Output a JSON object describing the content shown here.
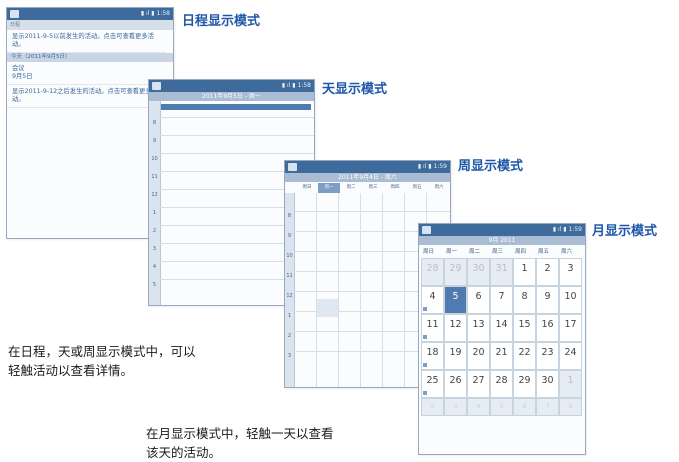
{
  "status_bar": {
    "agenda_time": "1:58",
    "day_time": "1:58",
    "week_time": "1:59",
    "month_time": "1:59"
  },
  "mode_titles": {
    "agenda": "日程显示模式",
    "day": "天显示模式",
    "week": "周显示模式",
    "month": "月显示模式"
  },
  "agenda": {
    "top_bar": "日程",
    "item1": "显示2011-9-5以前发生的活动。点击可查看更多活动。",
    "section": "今天（2011年9月5日）",
    "event_title": "会议",
    "event_date": "9月5日",
    "item2": "显示2011-9-12之后发生的活动。点击可查看更多活动。"
  },
  "day": {
    "header": "2011年9月5日 - 周一",
    "hours": [
      "8",
      "9",
      "10",
      "11",
      "12",
      "1",
      "2",
      "3",
      "4",
      "5"
    ]
  },
  "week": {
    "header": "2011年9月4日 - 周六",
    "weekdays": [
      "周日",
      "周一",
      "周二",
      "周三",
      "周四",
      "周五",
      "周六"
    ],
    "hours": [
      "8",
      "9",
      "10",
      "11",
      "12",
      "1",
      "2",
      "3"
    ]
  },
  "month": {
    "header": "9月 2011",
    "weekdays": [
      "周日",
      "周一",
      "周二",
      "周三",
      "周四",
      "周五",
      "周六"
    ],
    "days": [
      [
        "28",
        "29",
        "30",
        "31",
        "1",
        "2",
        "3"
      ],
      [
        "4",
        "5",
        "6",
        "7",
        "8",
        "9",
        "10"
      ],
      [
        "11",
        "12",
        "13",
        "14",
        "15",
        "16",
        "17"
      ],
      [
        "18",
        "19",
        "20",
        "21",
        "22",
        "23",
        "24"
      ],
      [
        "25",
        "26",
        "27",
        "28",
        "29",
        "30",
        "1"
      ],
      [
        "2",
        "3",
        "4",
        "5",
        "6",
        "7",
        "8"
      ]
    ]
  },
  "captions": {
    "left_line1": "在日程，天或周显示模式中，可以",
    "left_line2": "轻触活动以查看详情。",
    "bottom_line1": "在月显示模式中，轻触一天以查看",
    "bottom_line2": "该天的活动。"
  }
}
